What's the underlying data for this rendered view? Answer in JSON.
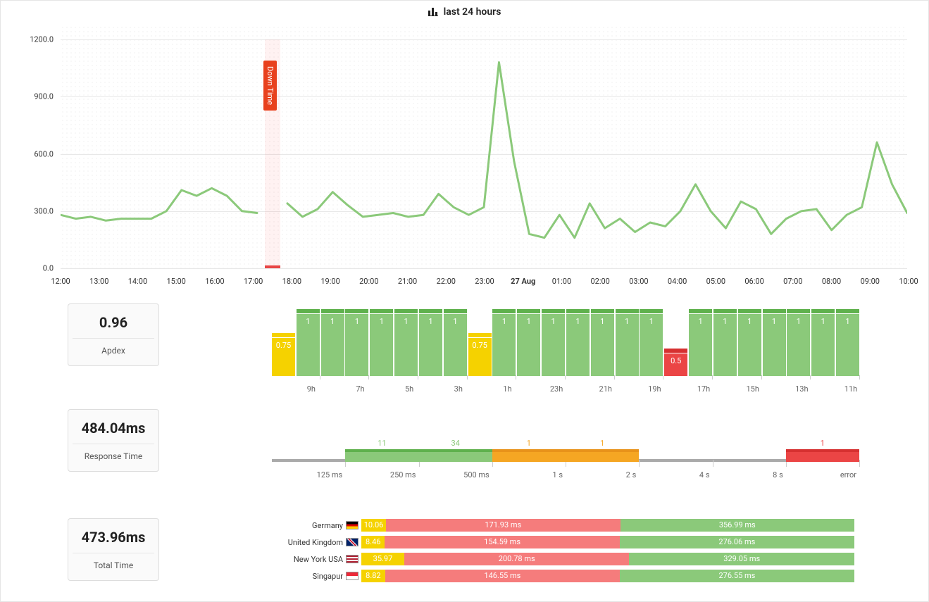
{
  "header": {
    "title": "last 24 hours"
  },
  "chart_data": [
    {
      "id": "response_line",
      "type": "line",
      "title": "last 24 hours",
      "ylabel": "",
      "ylim": [
        0,
        1200
      ],
      "y_ticks": [
        "0.0",
        "300.0",
        "600.0",
        "900.0",
        "1200.0"
      ],
      "x_labels": [
        "12:00",
        "13:00",
        "14:00",
        "15:00",
        "16:00",
        "17:00",
        "18:00",
        "19:00",
        "20:00",
        "21:00",
        "22:00",
        "23:00",
        "27 Aug",
        "01:00",
        "02:00",
        "03:00",
        "04:00",
        "05:00",
        "06:00",
        "07:00",
        "08:00",
        "09:00",
        "10:00"
      ],
      "downtime": {
        "label": "Down Time",
        "start_index": 5.3,
        "end_index": 5.7
      },
      "values": [
        280,
        260,
        270,
        250,
        260,
        260,
        260,
        300,
        410,
        380,
        420,
        380,
        300,
        290,
        null,
        340,
        270,
        310,
        400,
        330,
        270,
        280,
        290,
        270,
        280,
        390,
        320,
        280,
        320,
        1080,
        560,
        180,
        160,
        280,
        160,
        340,
        210,
        260,
        190,
        240,
        220,
        300,
        440,
        300,
        210,
        350,
        310,
        180,
        260,
        300,
        310,
        200,
        280,
        320,
        660,
        440,
        290
      ]
    },
    {
      "id": "apdex_hourly",
      "type": "bar",
      "categories_bottom": [
        "9h",
        "7h",
        "5h",
        "3h",
        "1h",
        "23h",
        "21h",
        "19h",
        "17h",
        "15h",
        "13h",
        "11h"
      ],
      "values": [
        0.75,
        1,
        1,
        1,
        1,
        1,
        1,
        1,
        0.75,
        1,
        1,
        1,
        1,
        1,
        1,
        1,
        0.5,
        1,
        1,
        1,
        1,
        1,
        1,
        1
      ],
      "colors": [
        "yellow",
        "green",
        "green",
        "green",
        "green",
        "green",
        "green",
        "green",
        "yellow",
        "green",
        "green",
        "green",
        "green",
        "green",
        "green",
        "green",
        "red",
        "green",
        "green",
        "green",
        "green",
        "green",
        "green",
        "green"
      ]
    },
    {
      "id": "response_dist",
      "type": "bar",
      "buckets": [
        "125 ms",
        "250 ms",
        "500 ms",
        "1 s",
        "2 s",
        "4 s",
        "8 s",
        "error"
      ],
      "series": [
        {
          "bucket": "250 ms",
          "count": 11,
          "color": "green"
        },
        {
          "bucket": "500 ms",
          "count": 34,
          "color": "green"
        },
        {
          "bucket": "1 s",
          "count": 1,
          "color": "orange"
        },
        {
          "bucket": "2 s",
          "count": 1,
          "color": "orange"
        },
        {
          "bucket": "error",
          "count": 1,
          "color": "red"
        }
      ]
    },
    {
      "id": "location_times",
      "type": "bar",
      "rows": [
        {
          "name": "Germany",
          "flag": "de",
          "a": 10.06,
          "b": "171.93 ms",
          "c": "356.99 ms"
        },
        {
          "name": "United Kingdom",
          "flag": "gb",
          "a": 8.46,
          "b": "154.59 ms",
          "c": "276.06 ms"
        },
        {
          "name": "New York USA",
          "flag": "us",
          "a": 35.97,
          "b": "200.78 ms",
          "c": "329.05 ms"
        },
        {
          "name": "Singapur",
          "flag": "sg",
          "a": 8.82,
          "b": "146.55 ms",
          "c": "276.55 ms"
        }
      ]
    }
  ],
  "stats": {
    "apdex": {
      "value": "0.96",
      "label": "Apdex"
    },
    "response": {
      "value": "484.04ms",
      "label": "Response Time"
    },
    "total": {
      "value": "473.96ms",
      "label": "Total Time"
    }
  },
  "flags": {
    "de": "linear-gradient(#000 33%,#dd0000 33%,#dd0000 66%,#ffce00 66%)",
    "gb": "linear-gradient(45deg,#012169 40%,#fff 40%,#fff 45%,#c8102e 45%,#c8102e 55%,#fff 55%,#fff 60%,#012169 60%)",
    "us": "repeating-linear-gradient(#b22234 0 2px,#fff 2px 4px)",
    "sg": "linear-gradient(#ed2939 50%,#fff 50%)"
  }
}
